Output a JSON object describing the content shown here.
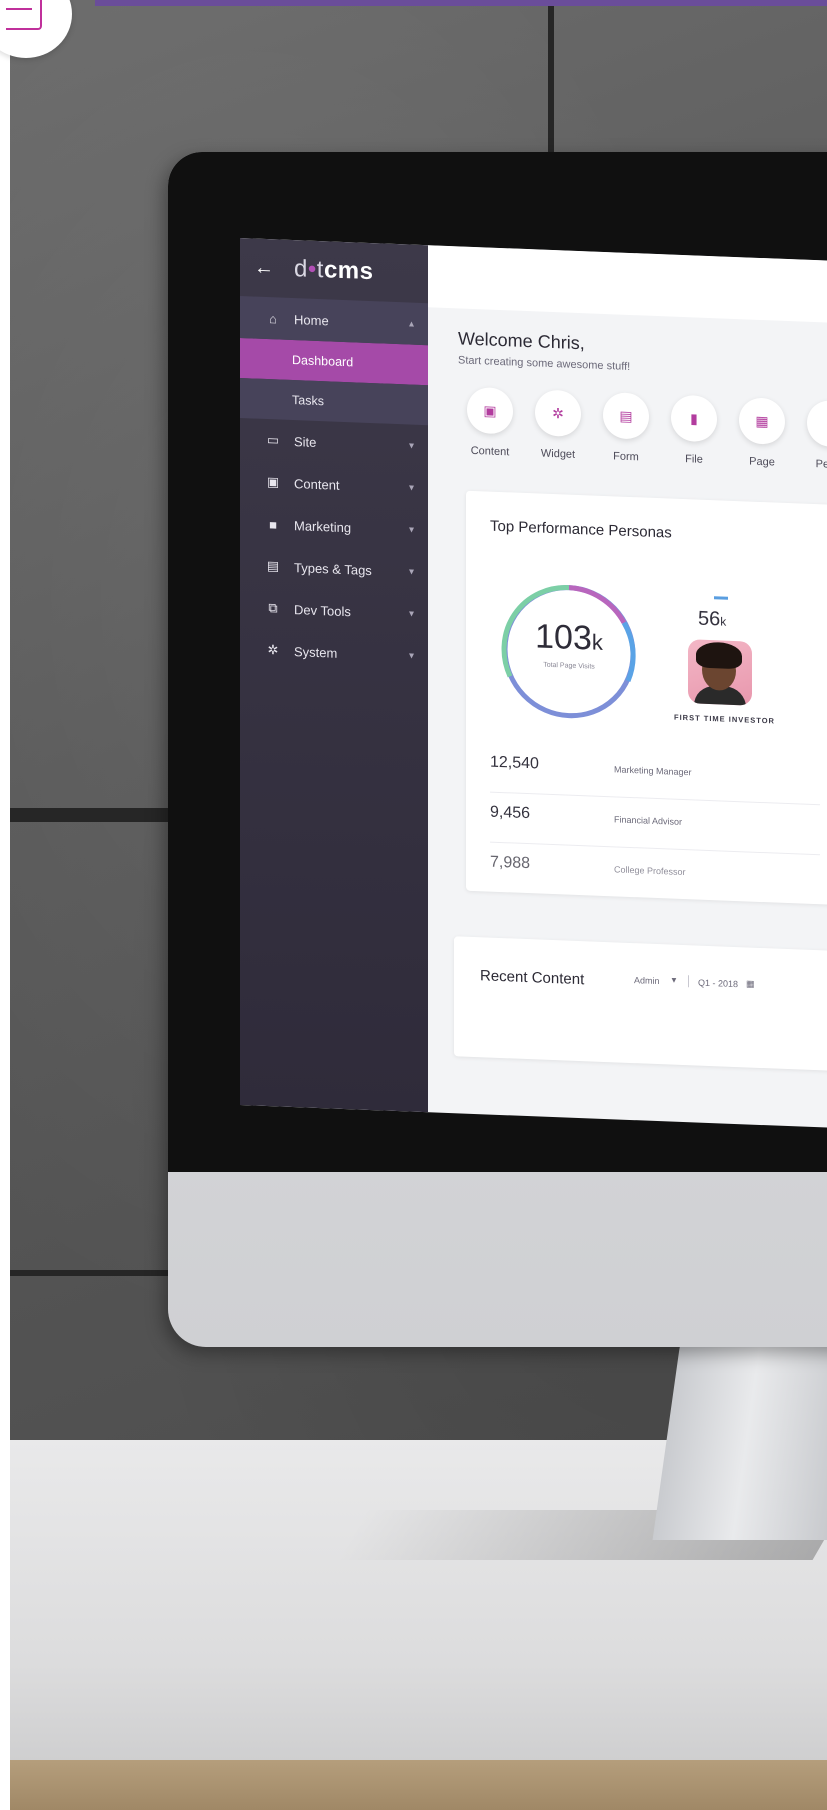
{
  "sidebar": {
    "back_icon": "arrow-left-icon",
    "logo": {
      "light": "d",
      "dot": "•",
      "light2": "t",
      "bold": "cms"
    },
    "items": [
      {
        "label": "Home",
        "icon": "home-icon",
        "expanded": true,
        "children": [
          {
            "label": "Dashboard",
            "active": true
          },
          {
            "label": "Tasks",
            "active": false
          }
        ]
      },
      {
        "label": "Site",
        "icon": "monitor-icon"
      },
      {
        "label": "Content",
        "icon": "folder-image-icon"
      },
      {
        "label": "Marketing",
        "icon": "briefcase-icon"
      },
      {
        "label": "Types & Tags",
        "icon": "card-icon"
      },
      {
        "label": "Dev Tools",
        "icon": "code-icon"
      },
      {
        "label": "System",
        "icon": "gear-icon"
      }
    ]
  },
  "welcome": {
    "title": "Welcome Chris,",
    "subtitle": "Start creating some awesome stuff!"
  },
  "quick_actions": [
    {
      "label": "Content",
      "icon": "content-icon"
    },
    {
      "label": "Widget",
      "icon": "widget-icon"
    },
    {
      "label": "Form",
      "icon": "form-icon"
    },
    {
      "label": "File",
      "icon": "file-icon"
    },
    {
      "label": "Page",
      "icon": "page-icon"
    },
    {
      "label": "Perso",
      "icon": "person-icon"
    }
  ],
  "personas_card": {
    "title": "Top Performance Personas",
    "total_value": "103",
    "total_unit": "k",
    "total_label": "Total Page Visits",
    "persona": {
      "count": "56",
      "unit": "k",
      "name": "FIRST TIME INVESTOR"
    },
    "rows": [
      {
        "value": "12,540",
        "label": "Marketing Manager"
      },
      {
        "value": "9,456",
        "label": "Financial Advisor"
      },
      {
        "value": "7,988",
        "label": "College Professor"
      }
    ]
  },
  "recent_card": {
    "title": "Recent Content",
    "filter": "Admin",
    "period": "Q1 - 2018",
    "calendar_icon": "calendar-icon"
  },
  "colors": {
    "accent": "#a54aa8",
    "sidebar": "#3d3949",
    "topbar": "#6a4d9a"
  }
}
